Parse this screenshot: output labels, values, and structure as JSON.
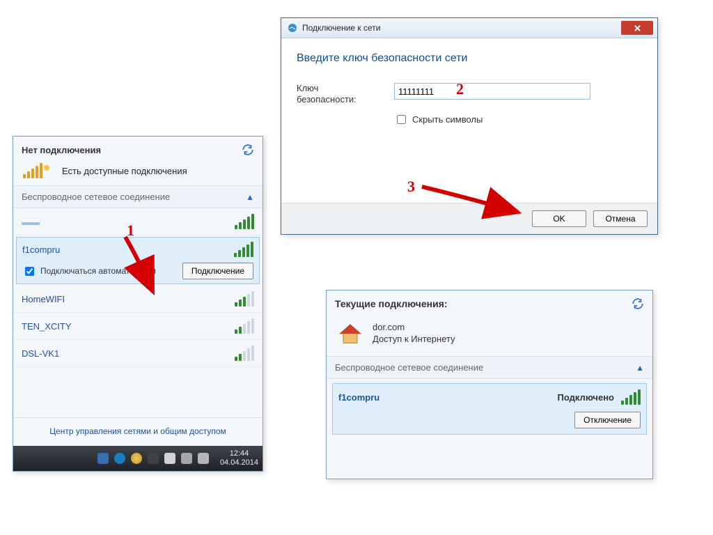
{
  "panel1": {
    "header": "Нет подключения",
    "available": "Есть доступные подключения",
    "section_title": "Беспроводное сетевое соединение",
    "selected": {
      "name": "f1compru",
      "auto_connect_label": "Подключаться автоматически",
      "auto_connect_checked": true,
      "connect_button": "Подключение"
    },
    "networks": [
      {
        "name": "",
        "signal": "dim"
      },
      {
        "name": "f1compru",
        "signal": "green"
      },
      {
        "name": "HomeWIFI",
        "signal": "mixed3"
      },
      {
        "name": "TEN_XCITY",
        "signal": "mixed"
      },
      {
        "name": "DSL-VK1",
        "signal": "mixed"
      }
    ],
    "footer_link": "Центр управления сетями и общим доступом",
    "clock": {
      "time": "12:44",
      "date": "04.04.2014"
    }
  },
  "dialog": {
    "title": "Подключение к сети",
    "heading": "Введите ключ безопасности сети",
    "key_label_1": "Ключ",
    "key_label_2": "безопасности:",
    "key_value": "11111111",
    "hide_chars": "Скрыть символы",
    "ok": "OK",
    "cancel": "Отмена"
  },
  "panel2": {
    "header": "Текущие подключения:",
    "site": "dor.com",
    "access": "Доступ к Интернету",
    "section_title": "Беспроводное сетевое соединение",
    "conn_name": "f1compru",
    "conn_status": "Подключено",
    "disconnect": "Отключение"
  },
  "annotations": {
    "n1": "1",
    "n2": "2",
    "n3": "3"
  }
}
